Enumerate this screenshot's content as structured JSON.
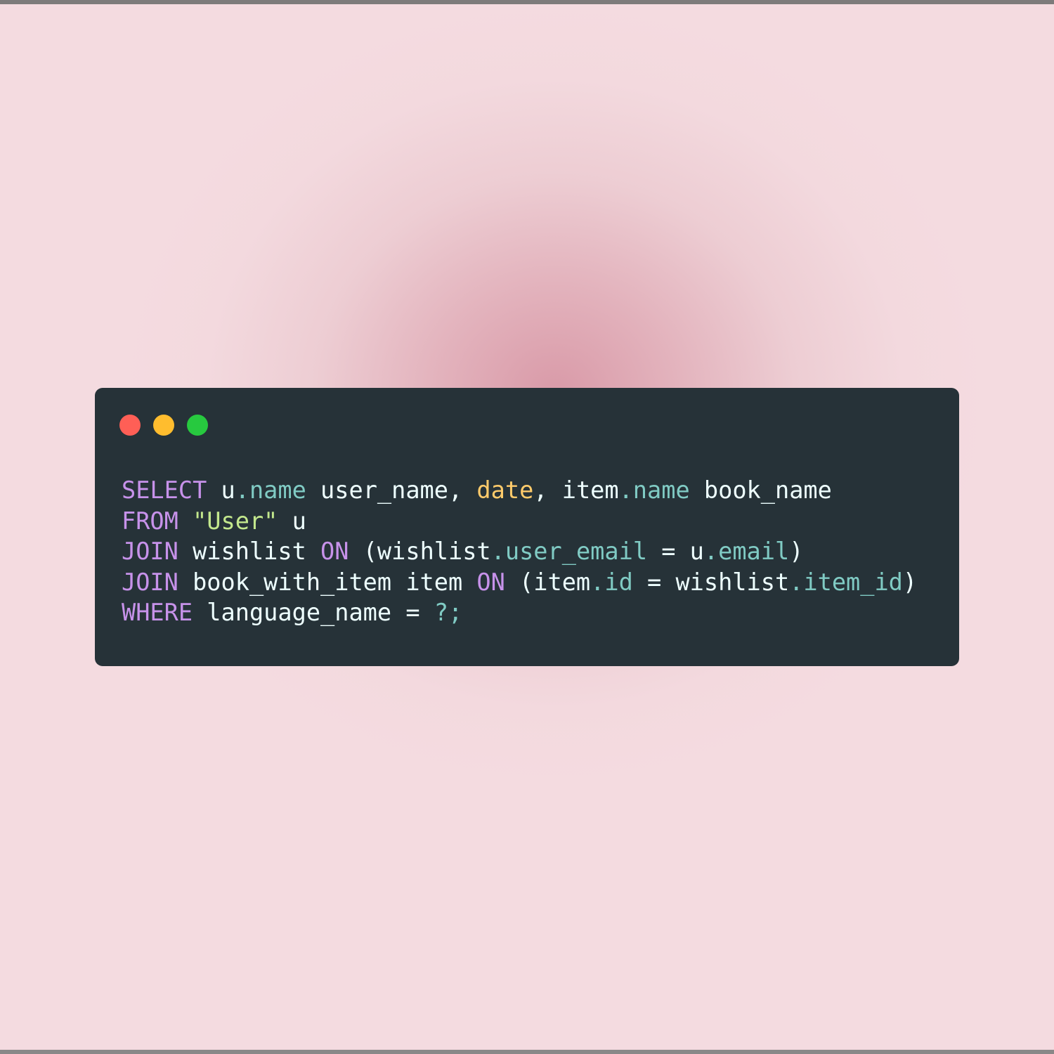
{
  "theme": {
    "window_bg": "#263238",
    "keyword": "#c792ea",
    "identifier": "#eeffff",
    "property": "#80cbc4",
    "function": "#ffcb6b",
    "string": "#c3e88d"
  },
  "window_controls": [
    {
      "name": "close",
      "color": "#ff5f56"
    },
    {
      "name": "minimize",
      "color": "#ffbd2e"
    },
    {
      "name": "maximize",
      "color": "#27c93f"
    }
  ],
  "code": {
    "language": "sql",
    "lines": [
      [
        {
          "t": "SELECT",
          "c": "kw"
        },
        {
          "t": " u",
          "c": "id"
        },
        {
          "t": ".name",
          "c": "prop"
        },
        {
          "t": " user_name, ",
          "c": "id"
        },
        {
          "t": "date",
          "c": "fn"
        },
        {
          "t": ", item",
          "c": "id"
        },
        {
          "t": ".name",
          "c": "prop"
        },
        {
          "t": " book_name",
          "c": "id"
        }
      ],
      [
        {
          "t": "FROM",
          "c": "kw"
        },
        {
          "t": " ",
          "c": "id"
        },
        {
          "t": "\"User\"",
          "c": "str"
        },
        {
          "t": " u",
          "c": "id"
        }
      ],
      [
        {
          "t": "JOIN",
          "c": "kw"
        },
        {
          "t": " wishlist ",
          "c": "id"
        },
        {
          "t": "ON",
          "c": "kw"
        },
        {
          "t": " (wishlist",
          "c": "id"
        },
        {
          "t": ".user_email",
          "c": "prop"
        },
        {
          "t": " = u",
          "c": "id"
        },
        {
          "t": ".email",
          "c": "prop"
        },
        {
          "t": ")",
          "c": "id"
        }
      ],
      [
        {
          "t": "JOIN",
          "c": "kw"
        },
        {
          "t": " book_with_item item ",
          "c": "id"
        },
        {
          "t": "ON",
          "c": "kw"
        },
        {
          "t": " (item",
          "c": "id"
        },
        {
          "t": ".id",
          "c": "prop"
        },
        {
          "t": " = wishlist",
          "c": "id"
        },
        {
          "t": ".item_id",
          "c": "prop"
        },
        {
          "t": ")",
          "c": "id"
        }
      ],
      [
        {
          "t": "WHERE",
          "c": "kw"
        },
        {
          "t": " language_name = ",
          "c": "id"
        },
        {
          "t": "?;",
          "c": "prop"
        }
      ]
    ]
  }
}
